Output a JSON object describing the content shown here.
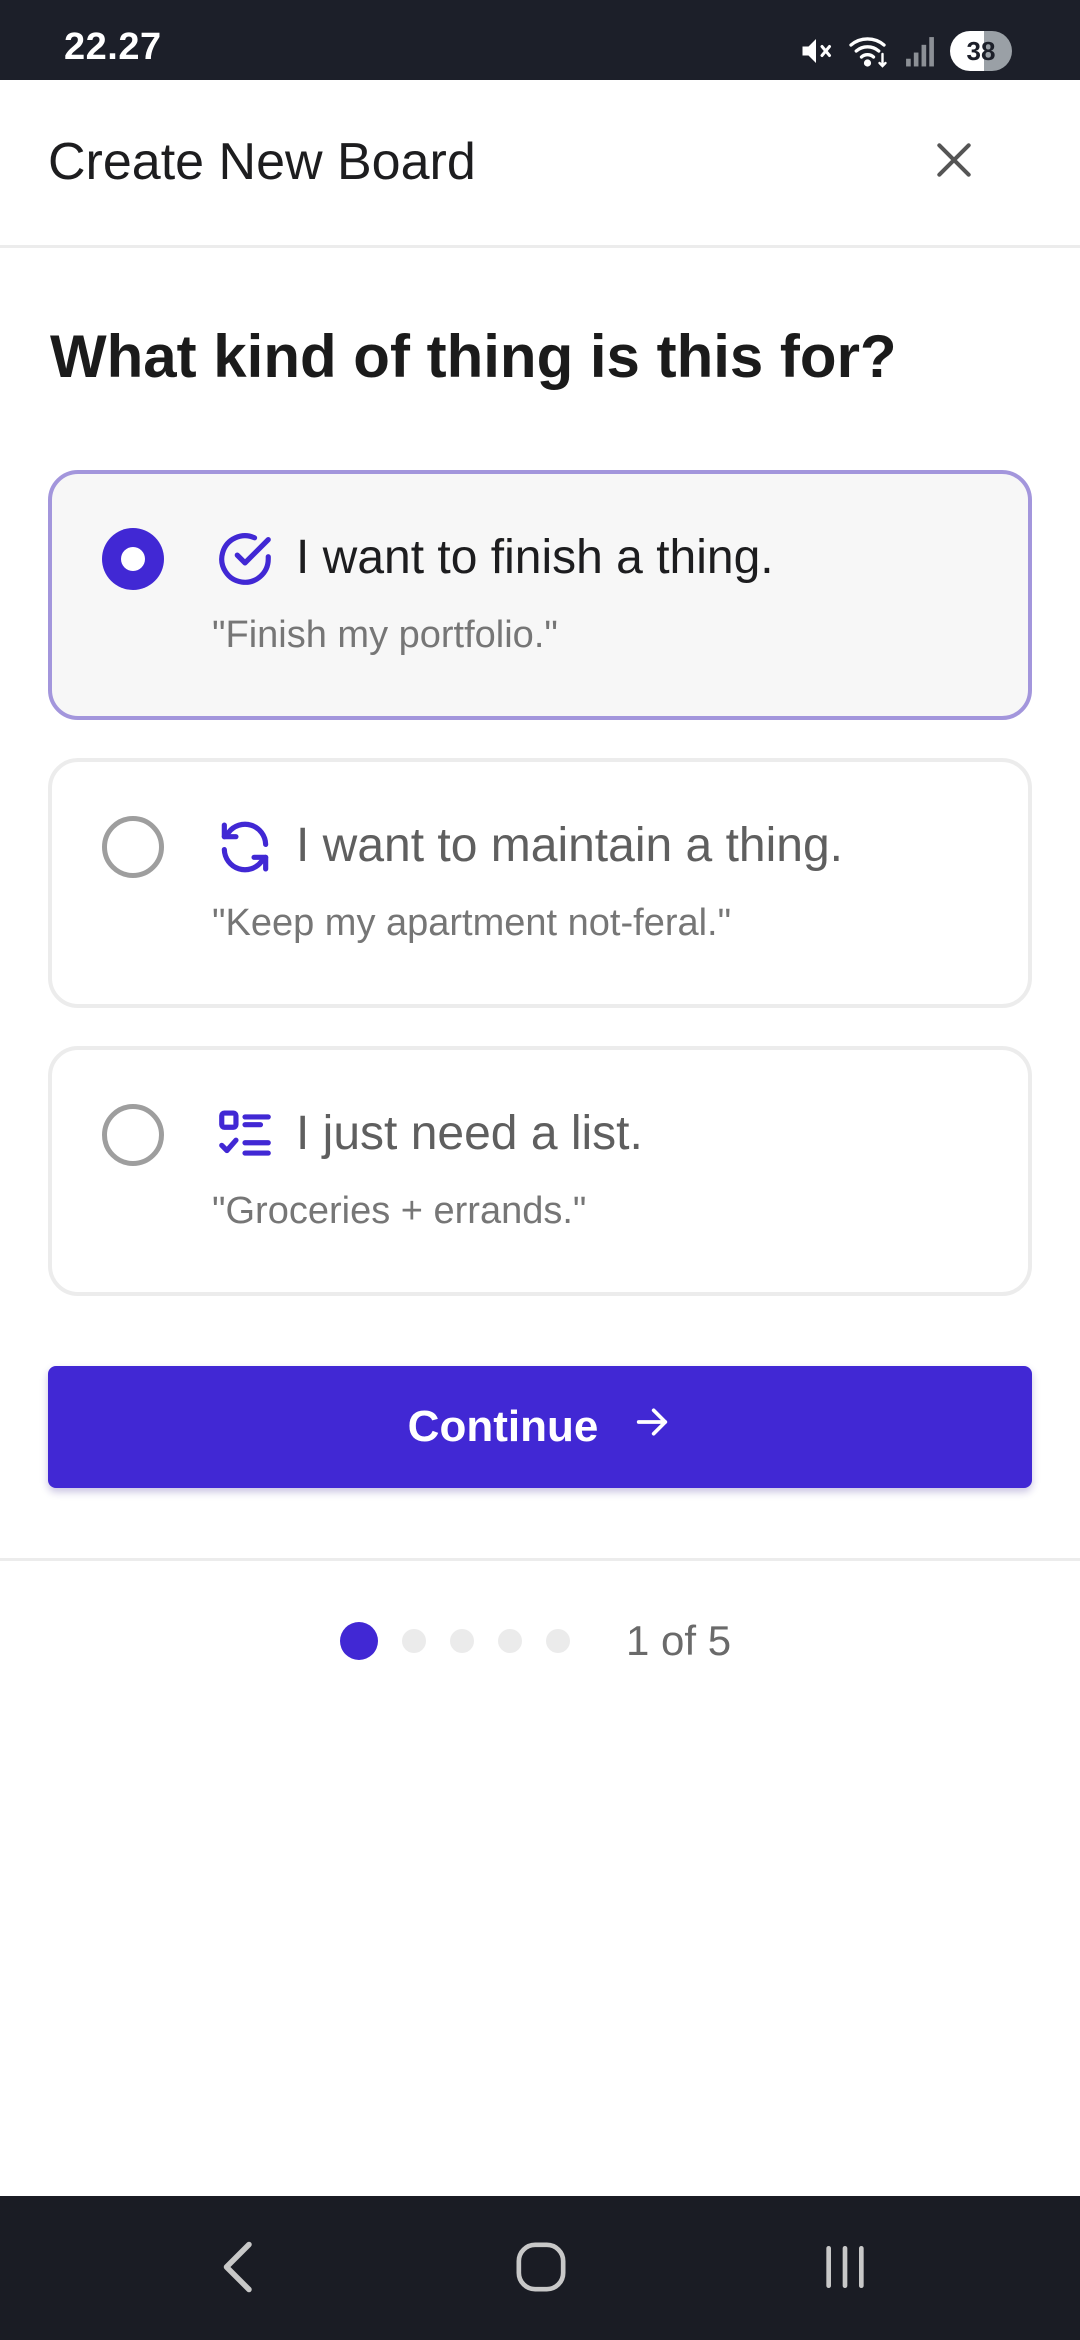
{
  "status_bar": {
    "time": "22.27",
    "battery": "38",
    "icons": [
      "mute-icon",
      "wifi-icon",
      "signal-icon",
      "battery-icon"
    ]
  },
  "header": {
    "title": "Create New Board",
    "close_icon": "close-icon"
  },
  "question": "What kind of thing is this for?",
  "options": [
    {
      "id": "finish",
      "icon": "check-circle-icon",
      "title": "I want to finish a thing.",
      "description": "\"Finish my portfolio.\"",
      "selected": true
    },
    {
      "id": "maintain",
      "icon": "refresh-icon",
      "title": "I want to maintain a thing.",
      "description": "\"Keep my apartment not-feral.\"",
      "selected": false
    },
    {
      "id": "list",
      "icon": "checklist-icon",
      "title": "I just need a list.",
      "description": "\"Groceries + errands.\"",
      "selected": false
    }
  ],
  "continue_button": {
    "label": "Continue",
    "icon": "arrow-right-icon"
  },
  "pager": {
    "current": 1,
    "total": 5,
    "label": "1 of 5"
  },
  "nav_bar": {
    "buttons": [
      "back-icon",
      "home-icon",
      "recents-icon"
    ]
  },
  "colors": {
    "accent": "#4128d4",
    "selected_border": "#a396dc",
    "status_bar": "#1c1f29",
    "nav_bar": "#1a1c24"
  }
}
